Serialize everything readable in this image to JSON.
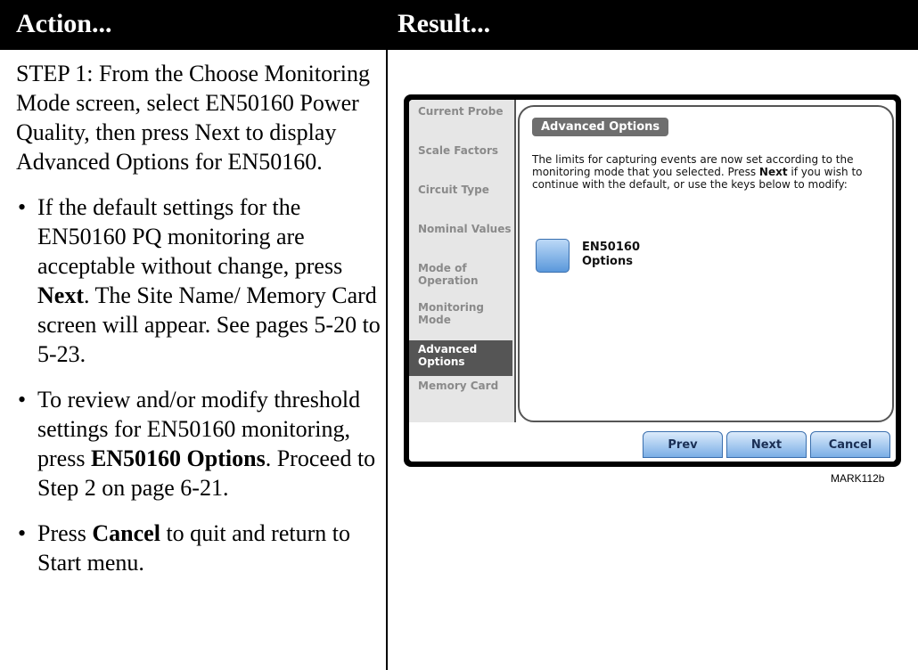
{
  "header": {
    "action": "Action...",
    "result": "Result..."
  },
  "left": {
    "step": "STEP 1: From the Choose Monitoring Mode screen, select EN50160 Power Quality, then press Next to display Advanced Options for EN50160.",
    "b1_pre": "If the default settings for the EN50160 PQ monitoring are acceptable without change, press ",
    "b1_bold": "Next",
    "b1_post": ". The Site Name/ Memory Card screen will appear. See pages 5-20 to 5-23.",
    "b2_pre": "To review and/or modify threshold settings for EN50160 monitoring, press ",
    "b2_bold": "EN50160 Options",
    "b2_post": ". Proceed to Step 2 on page 6-21.",
    "b3_pre": "Press ",
    "b3_bold": "Cancel",
    "b3_post": " to quit and return to Start menu."
  },
  "device": {
    "tabs": [
      "Current Probe",
      "Scale Factors",
      "Circuit Type",
      "Nominal Values",
      "Mode of Operation",
      "Monitoring Mode",
      "Advanced Options",
      "Memory Card"
    ],
    "active_tab": "Advanced Options",
    "panel_title": "Advanced Options",
    "desc_pre": "The limits for capturing events are now set according to the monitoring mode that you selected. Press ",
    "desc_bold": "Next",
    "desc_post": " if you wish to continue with the default, or use the keys below to modify:",
    "option_label_1": "EN50160",
    "option_label_2": "Options",
    "buttons": {
      "prev": "Prev",
      "next": "Next",
      "cancel": "Cancel"
    }
  },
  "caption": "MARK112b"
}
